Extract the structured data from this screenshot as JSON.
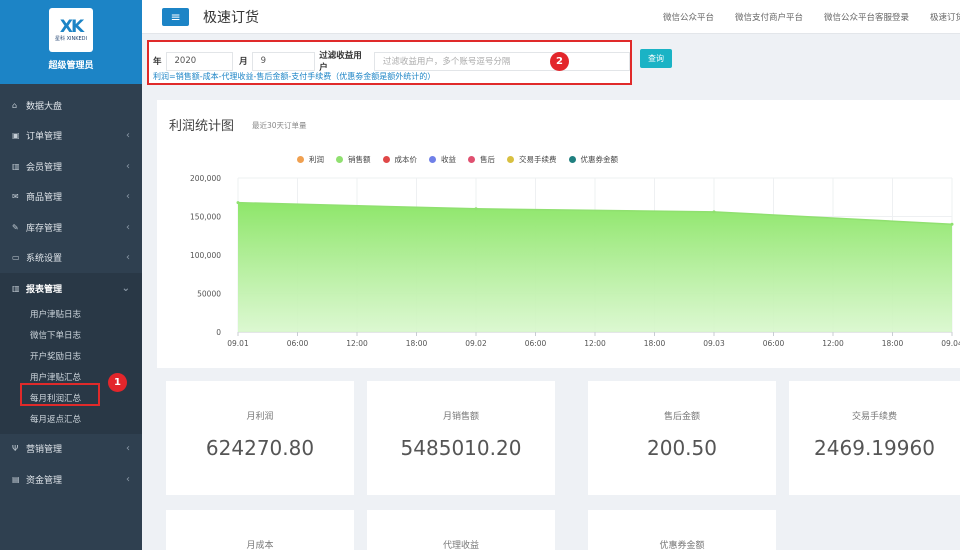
{
  "brand": {
    "logo_mark": "XK",
    "logo_text": "星科 XINKEDI",
    "name": "超级管理员"
  },
  "sidebar": {
    "items": [
      {
        "label": "数据大盘",
        "icon": "home-icon",
        "glyph": "⌂",
        "arrow": ""
      },
      {
        "label": "订单管理",
        "icon": "order-icon",
        "glyph": "▣",
        "arrow": "‹"
      },
      {
        "label": "会员管理",
        "icon": "member-chart-icon",
        "glyph": "▥",
        "arrow": "‹"
      },
      {
        "label": "商品管理",
        "icon": "envelope-icon",
        "glyph": "✉",
        "arrow": "‹"
      },
      {
        "label": "库存管理",
        "icon": "edit-icon",
        "glyph": "✎",
        "arrow": "‹"
      },
      {
        "label": "系统设置",
        "icon": "monitor-icon",
        "glyph": "▭",
        "arrow": "‹"
      },
      {
        "label": "报表管理",
        "icon": "report-chart-icon",
        "glyph": "▥",
        "arrow": "⌄"
      }
    ],
    "sub_items": [
      {
        "label": "用户津贴日志"
      },
      {
        "label": "微信下单日志"
      },
      {
        "label": "开户奖励日志"
      },
      {
        "label": "用户津贴汇总"
      },
      {
        "label": "每月利润汇总"
      },
      {
        "label": "每月返点汇总"
      }
    ],
    "bottom_items": [
      {
        "label": "营销管理",
        "icon": "marketing-icon",
        "glyph": "Ψ",
        "arrow": "‹"
      },
      {
        "label": "资金管理",
        "icon": "money-icon",
        "glyph": "▤",
        "arrow": "‹"
      }
    ]
  },
  "header": {
    "toggle_icon": "≡",
    "title": "极速订货",
    "links": [
      "微信公众平台",
      "微信支付商户平台",
      "微信公众平台客服登录",
      "极速订货"
    ]
  },
  "filter": {
    "year_label": "年",
    "year_value": "2020",
    "month_label": "月",
    "month_value": "9",
    "user_label": "过滤收益用户",
    "user_placeholder": "过滤收益用户，多个账号逗号分隔",
    "formula": "利润=销售额-成本-代理收益-售后金额-支付手续费（优惠劵金额是额外统计的）",
    "query_label": "查询"
  },
  "markers": {
    "one": "1",
    "two": "2"
  },
  "chart_panel": {
    "title": "利润统计图",
    "subtitle": "最近30天订单量"
  },
  "chart_data": {
    "type": "area",
    "title": "利润统计图",
    "subtitle": "最近30天订单量",
    "legend": [
      {
        "name": "利润",
        "color": "#f0a050"
      },
      {
        "name": "销售额",
        "color": "#90e070"
      },
      {
        "name": "成本价",
        "color": "#e04848"
      },
      {
        "name": "收益",
        "color": "#7080e8"
      },
      {
        "name": "售后",
        "color": "#e05070"
      },
      {
        "name": "交易手续费",
        "color": "#d8c040"
      },
      {
        "name": "优惠券金额",
        "color": "#208080"
      }
    ],
    "x_ticks": [
      "09.01",
      "06:00",
      "12:00",
      "18:00",
      "09.02",
      "06:00",
      "12:00",
      "18:00",
      "09.03",
      "06:00",
      "12:00",
      "18:00",
      "09.04"
    ],
    "y_ticks": [
      "200,000",
      "150,000",
      "100,000",
      "50000",
      "0"
    ],
    "ylim": [
      0,
      200000
    ],
    "series": [
      {
        "name": "销售额",
        "color": "#90e070",
        "points": [
          [
            0,
            168000
          ],
          [
            4,
            160000
          ],
          [
            8,
            156000
          ],
          [
            12,
            140000
          ]
        ]
      }
    ]
  },
  "stats": [
    {
      "label": "月利润",
      "value": "624270.80"
    },
    {
      "label": "月销售额",
      "value": "5485010.20"
    },
    {
      "label": "售后金额",
      "value": "200.50"
    },
    {
      "label": "交易手续费",
      "value": "2469.19960"
    },
    {
      "label": "月成本",
      "value": ""
    },
    {
      "label": "代理收益",
      "value": ""
    },
    {
      "label": "优惠券金额",
      "value": ""
    }
  ]
}
